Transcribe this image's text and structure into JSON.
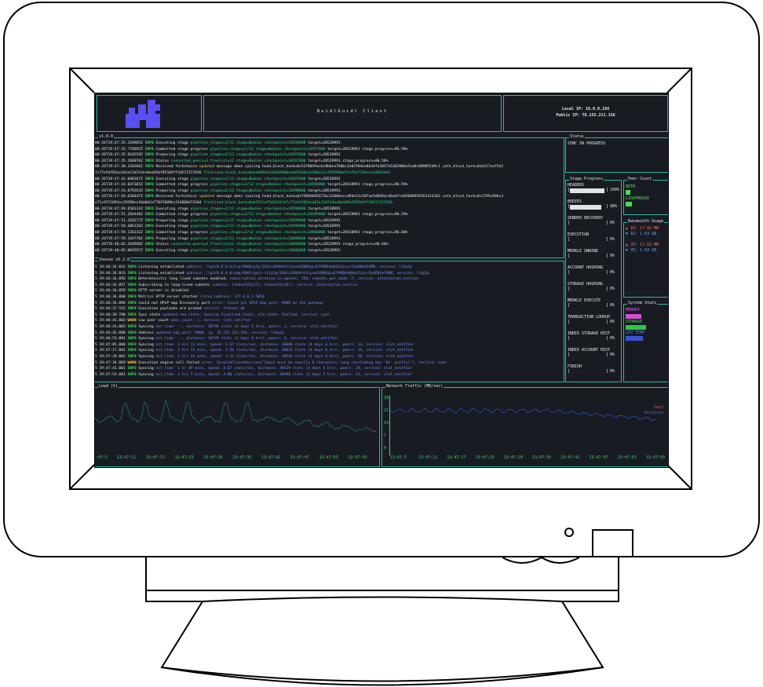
{
  "client": {
    "title": "BuidlGuidl Client",
    "local_ip": "Local IP: 10.0.0.184",
    "public_ip": "Public IP: 76.155.211.156"
  },
  "colors": {
    "terminal_bg": "#181c22",
    "border": "#2fb5a6",
    "green": "#46e05a",
    "blue": "#7f8cff",
    "logo": "#5a4ef0"
  },
  "panels": {
    "execution": "v1.0.0",
    "consensus": "thouse v5.2.0",
    "status": "Status",
    "stage_progress": "Stage Progress",
    "peer_count": "Peer Count",
    "bandwidth": "Bandwidth Usage",
    "system_stats": "System Stats",
    "cpu": "Load (%)",
    "network": "Network Traffic (MB/sec)"
  },
  "status": {
    "text": "SYNC IN PROGRESS"
  },
  "stages": [
    {
      "name": "HEADERS",
      "pct": "100%",
      "fill": 1.0
    },
    {
      "name": "BODIES",
      "pct": "90%",
      "fill": 0.9
    },
    {
      "name": "SENDER RECOVERY",
      "pct": "0%",
      "fill": 0
    },
    {
      "name": "EXECUTION",
      "pct": "0%",
      "fill": 0
    },
    {
      "name": "MERKLE UNWIND",
      "pct": "0%",
      "fill": 0
    },
    {
      "name": "ACCOUNT HASHING",
      "pct": "0%",
      "fill": 0
    },
    {
      "name": "STORAGE HASHING",
      "pct": "0%",
      "fill": 0
    },
    {
      "name": "MERKLE EXECUTE",
      "pct": "0%",
      "fill": 0
    },
    {
      "name": "TRANSACTION LOOKUP",
      "pct": "0%",
      "fill": 0
    },
    {
      "name": "INDEX STORAGE HIST",
      "pct": "0%",
      "fill": 0
    },
    {
      "name": "INDEX ACCOUNT HIST",
      "pct": "0%",
      "fill": 0
    },
    {
      "name": "FINISH",
      "pct": "0%",
      "fill": 0
    }
  ],
  "peers": {
    "reth": "RETH",
    "lighthouse": "LIGHTHOUSE"
  },
  "bandwidth": {
    "in1": "▲ 1D: 17.02 MB",
    "in2": "▼ 1D: 1.63 GB",
    "out1": "▲ 7D: 17.02 MB",
    "out2": "▼ 7D: 1.63 GB"
  },
  "system": {
    "memory": "MEMORY",
    "storage": "STORAGE",
    "cpu_temp": "CPU TEMP"
  },
  "net_legend": {
    "sent": "Sent",
    "received": "Received"
  },
  "cpu_times": [
    ":47:5",
    "13:47:11",
    "13:47:17",
    "13:47:23",
    "13:47:29",
    "13:47:35",
    "13:47:41",
    "13:47:47",
    "13:47:53",
    "13:47:59"
  ],
  "net_times": [
    "13:47:5",
    "13:47:11",
    "13:47:17",
    "13:47:23",
    "13:47:29",
    "13:47:35",
    "13:47:41",
    "13:47:47",
    "13:47:53",
    "13:47:59"
  ],
  "net_axis": [
    "28",
    "21",
    "14",
    "7",
    "0"
  ],
  "execution_log": [
    {
      "ts": "08-26T19:47:35.210985Z",
      "lvl": "INFO",
      "msg": "Executing stage ",
      "kw": "pipeline_stages=2/12 stage=Bodies checkpoint=18596000",
      "rest": " target=20528991"
    },
    {
      "ts": "08-26T19:47:35.776692Z",
      "lvl": "INFO",
      "msg": "Committed stage progress ",
      "kw": "pipeline_stages=2/12 stage=Bodies checkpoint=18597000",
      "rest": " target=20528991 stage_progress=90.58%"
    },
    {
      "ts": "08-26T19:47:35.810259Z",
      "lvl": "INFO",
      "msg": "Preparing stage ",
      "kw": "pipeline_stages=2/12 stage=Bodies checkpoint=18597000",
      "rest": " target=20528991"
    },
    {
      "ts": "08-26T19:47:35.266076Z",
      "lvl": "INFO",
      "msg": "Status ",
      "kw": "connected_peers=3 freelist=12 stage=Bodies checkpoint=18597000",
      "rest": " target=20528991 stage_progress=90.58%"
    },
    {
      "ts": "08-26T19:47:38.328166Z",
      "lvl": "INFO",
      "msg": "Received forkchoice ",
      "kw": "updated",
      "rest": " message when syncing head_block_hash=0x52f0039acbc0b6ea760bc2e03f84ee0b34fa3037a5303986e5ea6c08985549c1 safe_block_hash=0xb317eaf5d2"
    },
    {
      "ts": "fc77e5df02ace61e13d7e3ec0edd5bf05344ff3d517227b56",
      "lvl": "",
      "msg": " ",
      "kw": "finalized_block_hash=0xeeb0942a1b6390d0ede833d0a1e286a11c2935960e57e74e7339cae1d824de5",
      "rest": ""
    },
    {
      "ts": "08-26T19:47:42.048167Z",
      "lvl": "INFO",
      "msg": "Executing stage ",
      "kw": "pipeline_stages=2/12 stage=Bodies checkpoint=18597000",
      "rest": " target=20528991"
    },
    {
      "ts": "08-26T19:47:43.047305Z",
      "lvl": "INFO",
      "msg": "Committed stage progress ",
      "kw": "pipeline_stages=2/12 stage=Bodies checkpoint=18598000",
      "rest": " target=20528991 stage_progress=90.59%"
    },
    {
      "ts": "08-26T19:47:43.079263Z",
      "lvl": "INFO",
      "msg": "Preparing stage ",
      "kw": "pipeline_stages=2/12 stage=Bodies checkpoint=18598000",
      "rest": " target=20528991"
    },
    {
      "ts": "08-26T19:47:44.628447Z",
      "lvl": "INFO",
      "msg": "Received forkchoice ",
      "kw": "updated",
      "rest": " message when syncing head_block_hash=0xf589db85672bc3108beccd9de13c587ae5d894dcd6a4fcdd5886958562414382 safe_block_hash=0x7295e90bc3"
    },
    {
      "ts": "e71c9721091ec29290ce10a0d2e7783f689bc216880d73204",
      "lvl": "",
      "msg": " ",
      "kw": "finalized_block_hash=0xb317eaf5d2e61fefc77a5df02ace61e13d7e3ec0edd5bf05344ff3d517227b56",
      "rest": ""
    },
    {
      "ts": "08-26T19:47:49.650133Z",
      "lvl": "INFO",
      "msg": "Executing stage ",
      "kw": "pipeline_stages=2/12 stage=Bodies checkpoint=18598000",
      "rest": " target=20528991"
    },
    {
      "ts": "08-26T19:47:51.284440Z",
      "lvl": "INFO",
      "msg": "Committed stage progress ",
      "kw": "pipeline_stages=2/12 stage=Bodies checkpoint=18599000",
      "rest": " target=20528991 stage_progress=90.59%"
    },
    {
      "ts": "08-26T19:47:51.328277Z",
      "lvl": "INFO",
      "msg": "Preparing stage ",
      "kw": "pipeline_stages=2/12 stage=Bodies checkpoint=18599000",
      "rest": " target=20528991"
    },
    {
      "ts": "08-26T19:47:58.406126Z",
      "lvl": "INFO",
      "msg": "Executing stage ",
      "kw": "pipeline_stages=2/12 stage=Bodies checkpoint=18599000",
      "rest": " target=20528991"
    },
    {
      "ts": "08-26T19:47:59.136232Z",
      "lvl": "INFO",
      "msg": "Committed stage progress ",
      "kw": "pipeline_stages=2/12 stage=Bodies checkpoint=18600000",
      "rest": " target=20528991 stage_progress=90.60%"
    },
    {
      "ts": "08-26T19:47:59.164770Z",
      "lvl": "INFO",
      "msg": "Preparing stage ",
      "kw": "pipeline_stages=2/12 stage=Bodies checkpoint=18600000",
      "rest": " target=20528991"
    },
    {
      "ts": "08-26T19:48:02.264988Z",
      "lvl": "INFO",
      "msg": "Status ",
      "kw": "connected_peers=4 freelist=12 stage=Bodies checkpoint=18600000",
      "rest": " target=20528991 stage_progress=90.60%"
    },
    {
      "ts": "08-26T19:48:05.083597Z",
      "lvl": "INFO",
      "msg": "Executing stage ",
      "kw": "pipeline_stages=2/12 stage=Bodies checkpoint=18600000",
      "rest": " target=20528991"
    }
  ],
  "consensus_log": [
    {
      "ts": "5 19:46:34.832",
      "lvl": "INFO",
      "msg": "Listening established ",
      "kw": "address: /ip4/0.0.0.0/tcp/9000/p2p/16Uiu2HAmVnt3iyvm1UQNXqLuEYPKDHoQbQx2jozrCmoD8XoFhMN, service: libp2p",
      "rest": ""
    },
    {
      "ts": "5 19:46:34.833",
      "lvl": "INFO",
      "msg": "Listening established ",
      "kw": "address: /ip4/0.0.0.0/udp/9001/quic-v1/p2p/16Uiu2HAmVnt3iyvm1UQNXqLuEYPKDHoQbQx2jozrCmoD8XoFhMN, service: libp2p",
      "rest": ""
    },
    {
      "ts": "5 19:46:34.856",
      "lvl": "INFO",
      "msg": "Deterministic long lived subnets enabled, ",
      "kw": "subscription_duration_in_epochs: 256, subnets_per_node: 2, service: attestation_service",
      "rest": ""
    },
    {
      "ts": "5 19:46:34.857",
      "lvl": "INFO",
      "msg": "Subscribing to long-lived subnets ",
      "kw": "subnets: [SubnetId(27), SubnetId(28)], service: attestation_service",
      "rest": ""
    },
    {
      "ts": "5 19:46:34.859",
      "lvl": "INFO",
      "msg": "HTTP server is disabled",
      "kw": "",
      "rest": ""
    },
    {
      "ts": "5 19:46:34.860",
      "lvl": "INFO",
      "msg": "Metrics HTTP server started ",
      "kw": "listen_address: 127.0.0.1:5054",
      "rest": ""
    },
    {
      "ts": "5 19:46:34.896",
      "lvl": "INFO",
      "msg": "Could not UPnP map Discovery port ",
      "kw": "error: Could not UPnP map port: 9000 on the gateway",
      "rest": ""
    },
    {
      "ts": "5 19:46:37.552",
      "lvl": "INFO",
      "msg": "Execution payloads are pruned ",
      "kw": "service: freezer_db",
      "rest": ""
    },
    {
      "ts": "5 19:46:39.700",
      "lvl": "INFO",
      "msg": "Sync state ",
      "kw": "updated new_state: Syncing Finalized Chain, old_state: Stalled, service: sync",
      "rest": ""
    },
    {
      "ts": "5 19:46:41.002",
      "lvl": "WARN",
      "msg": "Low peer count ",
      "kw": "peer_count: 1, service: slot_notifier",
      "rest": ""
    },
    {
      "ts": "5 19:46:41.003",
      "lvl": "INFO",
      "msg": "Syncing ",
      "kw": "est_time: --, distance: 30748 slots (4 days 6 hrs), peers: 1, service: slot_notifier",
      "rest": ""
    },
    {
      "ts": "5 19:46:42.090",
      "lvl": "INFO",
      "msg": "Address ",
      "kw": "updated udp_port: 9000, ip: 76.155.211.156, service: libp2p",
      "rest": ""
    },
    {
      "ts": "5 19:46:53.001",
      "lvl": "INFO",
      "msg": "Syncing ",
      "kw": "est_time: --, distance: 30749 slots (4 days 6 hrs), peers: 6, service: slot_notifier",
      "rest": ""
    },
    {
      "ts": "5 19:47:05.000",
      "lvl": "INFO",
      "msg": "Syncing ",
      "kw": "est_time: 3 hrs 11 mins, speed: 2.67 slots/sec, distance: 30686 slots (4 days 6 hrs), peers: 13, service: slot_notifier",
      "rest": ""
    },
    {
      "ts": "5 19:47:17.001",
      "lvl": "INFO",
      "msg": "Syncing ",
      "kw": "est_time: 2 hrs 23 mins, speed: 3.56 slots/sec, distance: 30623 slots (4 days 6 hrs), peers: 16, service: slot_notifier",
      "rest": ""
    },
    {
      "ts": "5 19:47:29.002",
      "lvl": "INFO",
      "msg": "Syncing ",
      "kw": "est_time: 2 hrs 32 mins, speed: 3.33 slots/sec, distance: 30592 slots (4 days 6 hrs), peers: 16, service: slot_notifier",
      "rest": ""
    },
    {
      "ts": "5 19:47:34.069",
      "lvl": "WARN",
      "msg": "Execution engine call failed ",
      "kw": "error: InvalidClientVersion(\"Input must be exactly 8 characters long (excluding any '0x' prefix)\"), service: exec",
      "rest": ""
    },
    {
      "ts": "5 19:47:41.001",
      "lvl": "INFO",
      "msg": "Syncing ",
      "kw": "est_time: 1 hr 49 mins, speed: 4.67 slots/sec, distance: 30529 slots (4 days 5 hrs), peers: 19, service: slot_notifier",
      "rest": ""
    },
    {
      "ts": "5 19:47:53.001",
      "lvl": "INFO",
      "msg": "Syncing ",
      "kw": "est_time: 2 hrs 7 mins, speed: 4.00 slots/sec, distance: 30498 slots (4 days 5 hrs), peers: 21, service: slot_notifier",
      "rest": ""
    }
  ]
}
